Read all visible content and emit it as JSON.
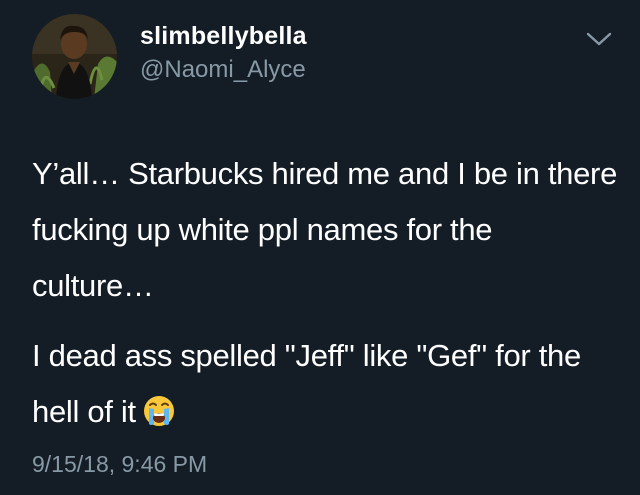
{
  "tweet": {
    "display_name": "slimbellybella",
    "handle": "@Naomi_Alyce",
    "paragraph_1": "Y’all… Starbucks hired me and I be in there fucking up white ppl names for the culture…",
    "paragraph_2": "I dead ass spelled \"Jeff\" like \"Gef\" for the hell of it",
    "timestamp": "9/15/18, 9:46 PM",
    "emoji_icon": "loudly-crying-face-icon",
    "menu_icon": "chevron-down-icon"
  },
  "colors": {
    "background": "#141d26",
    "primary_text": "#ffffff",
    "secondary_text": "#8899a6"
  }
}
